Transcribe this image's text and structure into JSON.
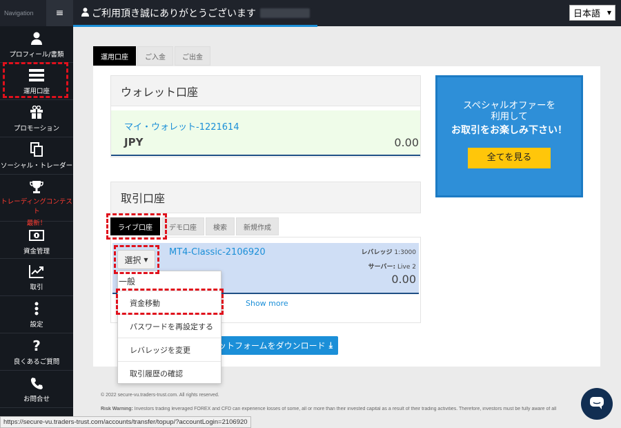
{
  "nav": {
    "label": "Navigation",
    "menu_icon": "≡"
  },
  "header": {
    "welcome": "ご利用頂き誠にありがとうございます",
    "language": "日本語"
  },
  "sidebar": {
    "items": [
      {
        "label": "プロフィール/書類",
        "icon": "user-icon"
      },
      {
        "label": "運用口座",
        "icon": "accounts-icon"
      },
      {
        "label": "プロモーション",
        "icon": "gift-icon"
      },
      {
        "label": "ソーシャル・トレーダー",
        "icon": "copy-icon"
      },
      {
        "label": "トレーディングコンテスト",
        "label2": "最新！",
        "icon": "trophy-icon"
      },
      {
        "label": "資金管理",
        "icon": "money-icon"
      },
      {
        "label": "取引",
        "icon": "chart-icon"
      },
      {
        "label": "設定",
        "icon": "dots-icon"
      },
      {
        "label": "良くあるご質問",
        "icon": "question-icon"
      },
      {
        "label": "お問合せ",
        "icon": "phone-icon"
      }
    ]
  },
  "main": {
    "tabs": [
      "運用口座",
      "ご入金",
      "ご出金"
    ],
    "wallet": {
      "title": "ウォレット口座",
      "name": "マイ・ウォレット-1221614",
      "currency": "JPY",
      "balance": "0.00"
    },
    "trading": {
      "title": "取引口座",
      "tabs": [
        "ライブ口座",
        "デモ口座",
        "検索",
        "新規作成"
      ],
      "select_label": "選択",
      "account": {
        "name": "MT4-Classic-2106920",
        "leverage_label": "レバレッジ",
        "leverage": "1:3000",
        "server_label": "サーバー:",
        "server": "Live 2",
        "balance": "0.00"
      },
      "show_more": "Show more",
      "download": "ットフォームをダウンロード"
    },
    "offer": {
      "line1": "スペシャルオファーを",
      "line2": "利用して",
      "line3": "お取引をお楽しみ下さい！",
      "button": "全てを見る"
    }
  },
  "dropdown": {
    "header": "一般",
    "items": [
      "資金移動",
      "パスワードを再設定する",
      "レバレッジを変更",
      "取引履歴の確認"
    ]
  },
  "footer": {
    "copyright": "© 2022 secure-vu.traders-trust.com. All rights reserved.",
    "risk_label": "Risk Warning:",
    "risk_text": "Investors trading leveraged FOREX and CFD can experience losses of some, all or more than their invested capital as a result of their trading activities. Therefore, investors must be fully aware of all"
  },
  "status_url": "https://secure-vu.traders-trust.com/accounts/transfer/topup/?accountLogin=2106920",
  "colors": {
    "accent": "#1b8fd8",
    "sidebar": "#15191f",
    "highlight": "#e0101c",
    "offer": "#2e8fd8",
    "button": "#ffc60a"
  }
}
